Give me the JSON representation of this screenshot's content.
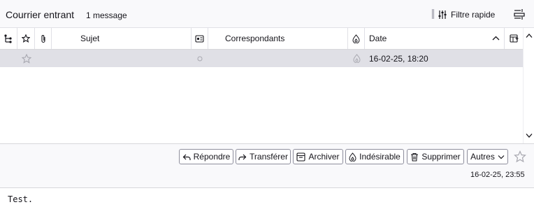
{
  "header": {
    "folder_title": "Courrier entrant",
    "message_count": "1 message",
    "quick_filter_label": "Filtre rapide",
    "quick_filter_icon": "filter-sliders-icon",
    "layout_icon": "layout-menu-icon"
  },
  "columns": {
    "thread_icon": "thread-icon",
    "star_icon": "star-icon",
    "attachment_icon": "paperclip-icon",
    "subject": "Sujet",
    "read_status_icon": "read-status-icon",
    "correspondents": "Correspondants",
    "junk_icon": "junk-icon",
    "date": "Date",
    "sort_direction": "ascending",
    "column_picker_icon": "column-picker-icon"
  },
  "messages": [
    {
      "starred": false,
      "subject": "",
      "read": true,
      "correspondent": "",
      "date": "16-02-25, 18:20",
      "selected": true
    }
  ],
  "message_pane": {
    "buttons": {
      "reply": "Répondre",
      "forward": "Transférer",
      "archive": "Archiver",
      "junk": "Indésirable",
      "delete": "Supprimer",
      "other": "Autres"
    },
    "date": "16-02-25, 23:55"
  },
  "body": {
    "text": "Test."
  },
  "colors": {
    "selected_row": "#e0e0e6",
    "header_bg": "#f9f9fb",
    "text": "#15141a",
    "border": "#8f8f9d"
  }
}
